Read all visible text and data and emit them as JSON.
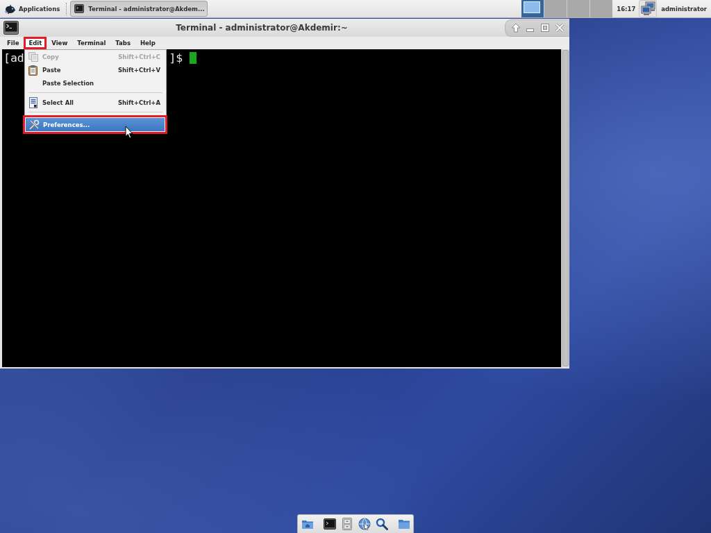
{
  "top_panel": {
    "applications": "Applications",
    "tasks": [
      {
        "label": "Terminal - administrator@Akdem...",
        "selected": true
      }
    ],
    "workspaces": [
      {
        "selected": true
      },
      {
        "selected": false
      },
      {
        "selected": false
      },
      {
        "selected": false
      }
    ],
    "clock": "16:17",
    "user": "administrator"
  },
  "window": {
    "title": "Terminal - administrator@Akdemir:~"
  },
  "menubar": [
    {
      "label": "File",
      "selected": false,
      "annotated": false
    },
    {
      "label": "Edit",
      "selected": true,
      "annotated": true
    },
    {
      "label": "View",
      "selected": false,
      "annotated": false
    },
    {
      "label": "Terminal",
      "selected": false,
      "annotated": false
    },
    {
      "label": "Tabs",
      "selected": false,
      "annotated": false
    },
    {
      "label": "Help",
      "selected": false,
      "annotated": false
    }
  ],
  "edit_menu": {
    "items": [
      {
        "kind": "item",
        "label": "Copy",
        "shortcut": "Shift+Ctrl+C",
        "disabled": true,
        "selected": false,
        "annotated": false
      },
      {
        "kind": "item",
        "label": "Paste",
        "shortcut": "Shift+Ctrl+V",
        "disabled": false,
        "selected": false,
        "annotated": false
      },
      {
        "kind": "item",
        "label": "Paste Selection",
        "disabled": false,
        "selected": false,
        "annotated": false
      },
      {
        "kind": "separator"
      },
      {
        "kind": "item",
        "label": "Select All",
        "shortcut": "Shift+Ctrl+A",
        "disabled": false,
        "selected": false,
        "annotated": false
      },
      {
        "kind": "separator"
      },
      {
        "kind": "item",
        "label": "Preferences...",
        "disabled": false,
        "selected": true,
        "annotated": true
      }
    ]
  },
  "terminal": {
    "prompt_start": "[ad",
    "prompt_end": "]$"
  }
}
